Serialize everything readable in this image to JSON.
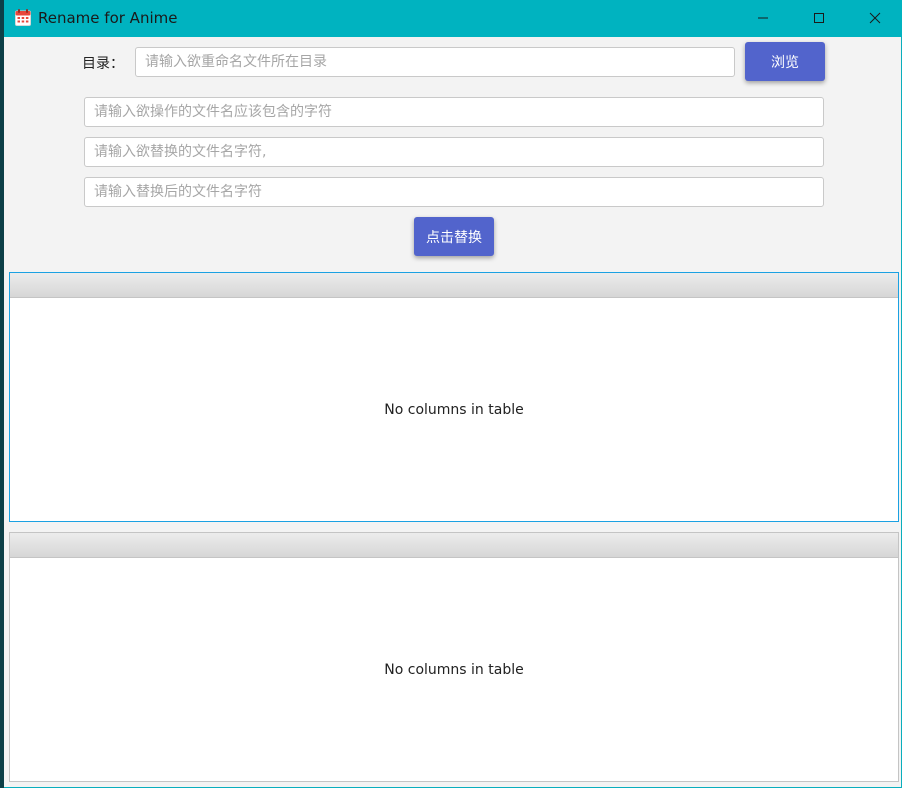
{
  "window": {
    "title": "Rename for Anime",
    "accent_color": "#00b3c0",
    "icons": {
      "app": "calendar-icon",
      "minimize": "minimize-icon",
      "maximize": "maximize-icon",
      "close": "close-icon"
    }
  },
  "directory": {
    "label": "目录：",
    "value": "",
    "placeholder": "请输入欲重命名文件所在目录",
    "browse_label": "浏览"
  },
  "filters": {
    "contains": {
      "value": "",
      "placeholder": "请输入欲操作的文件名应该包含的字符"
    },
    "replace_from": {
      "value": "",
      "placeholder": "请输入欲替换的文件名字符,"
    },
    "replace_to": {
      "value": "",
      "placeholder": "请输入替换后的文件名字符"
    }
  },
  "replace_button_label": "点击替换",
  "button_color": "#5264cc",
  "tables": {
    "before": {
      "empty_text": "No columns in table"
    },
    "after": {
      "empty_text": "No columns in table"
    }
  }
}
